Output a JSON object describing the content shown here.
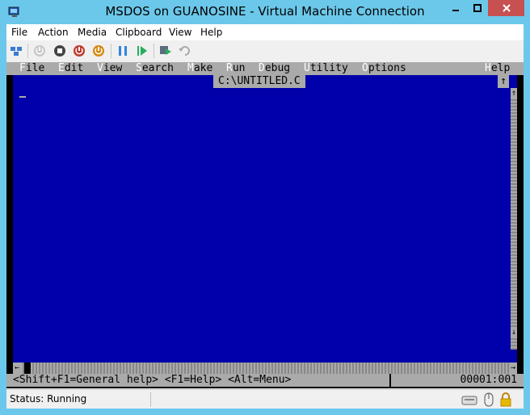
{
  "window": {
    "title": "MSDOS on GUANOSINE - Virtual Machine Connection"
  },
  "menubar": {
    "items": [
      {
        "label": "File",
        "name": "menu-file"
      },
      {
        "label": "Action",
        "name": "menu-action"
      },
      {
        "label": "Media",
        "name": "menu-media"
      },
      {
        "label": "Clipboard",
        "name": "menu-clipboard"
      },
      {
        "label": "View",
        "name": "menu-view"
      },
      {
        "label": "Help",
        "name": "menu-help"
      }
    ]
  },
  "toolbar": {
    "buttons": [
      {
        "icon": "ctrl-alt-del-icon"
      },
      {
        "icon": "start-icon"
      },
      {
        "icon": "turn-off-icon"
      },
      {
        "icon": "shut-down-icon"
      },
      {
        "icon": "save-state-icon"
      },
      {
        "icon": "pause-icon"
      },
      {
        "icon": "resume-icon"
      },
      {
        "icon": "checkpoint-icon"
      },
      {
        "icon": "revert-icon"
      }
    ]
  },
  "dos": {
    "menu": {
      "file": {
        "hot": "F",
        "rest": "ile"
      },
      "edit": {
        "hot": "E",
        "rest": "dit"
      },
      "view": {
        "hot": "V",
        "rest": "iew"
      },
      "search": {
        "hot": "S",
        "rest": "earch"
      },
      "make": {
        "hot": "M",
        "rest": "ake"
      },
      "run": {
        "hot": "R",
        "rest": "un"
      },
      "debug": {
        "hot": "D",
        "rest": "ebug"
      },
      "utility": {
        "hot": "U",
        "rest": "tility"
      },
      "options": {
        "hot": "O",
        "rest": "ptions"
      },
      "help": {
        "hot": "H",
        "rest": "elp"
      }
    },
    "editor": {
      "filename": "C:\\UNTITLED.C",
      "maximize_glyph": "↑",
      "scroll_up_glyph": "↑",
      "scroll_down_glyph": "↓",
      "scroll_left_glyph": "←",
      "scroll_right_glyph": "→"
    },
    "status": {
      "help_hint": "<Shift+F1=General help> <F1=Help> <Alt=Menu>",
      "position": "00001:001"
    },
    "colors": {
      "editor_bg": "#0000aa",
      "menu_bg": "#aaaaaa"
    }
  },
  "statusbar": {
    "status": "Status: Running"
  }
}
